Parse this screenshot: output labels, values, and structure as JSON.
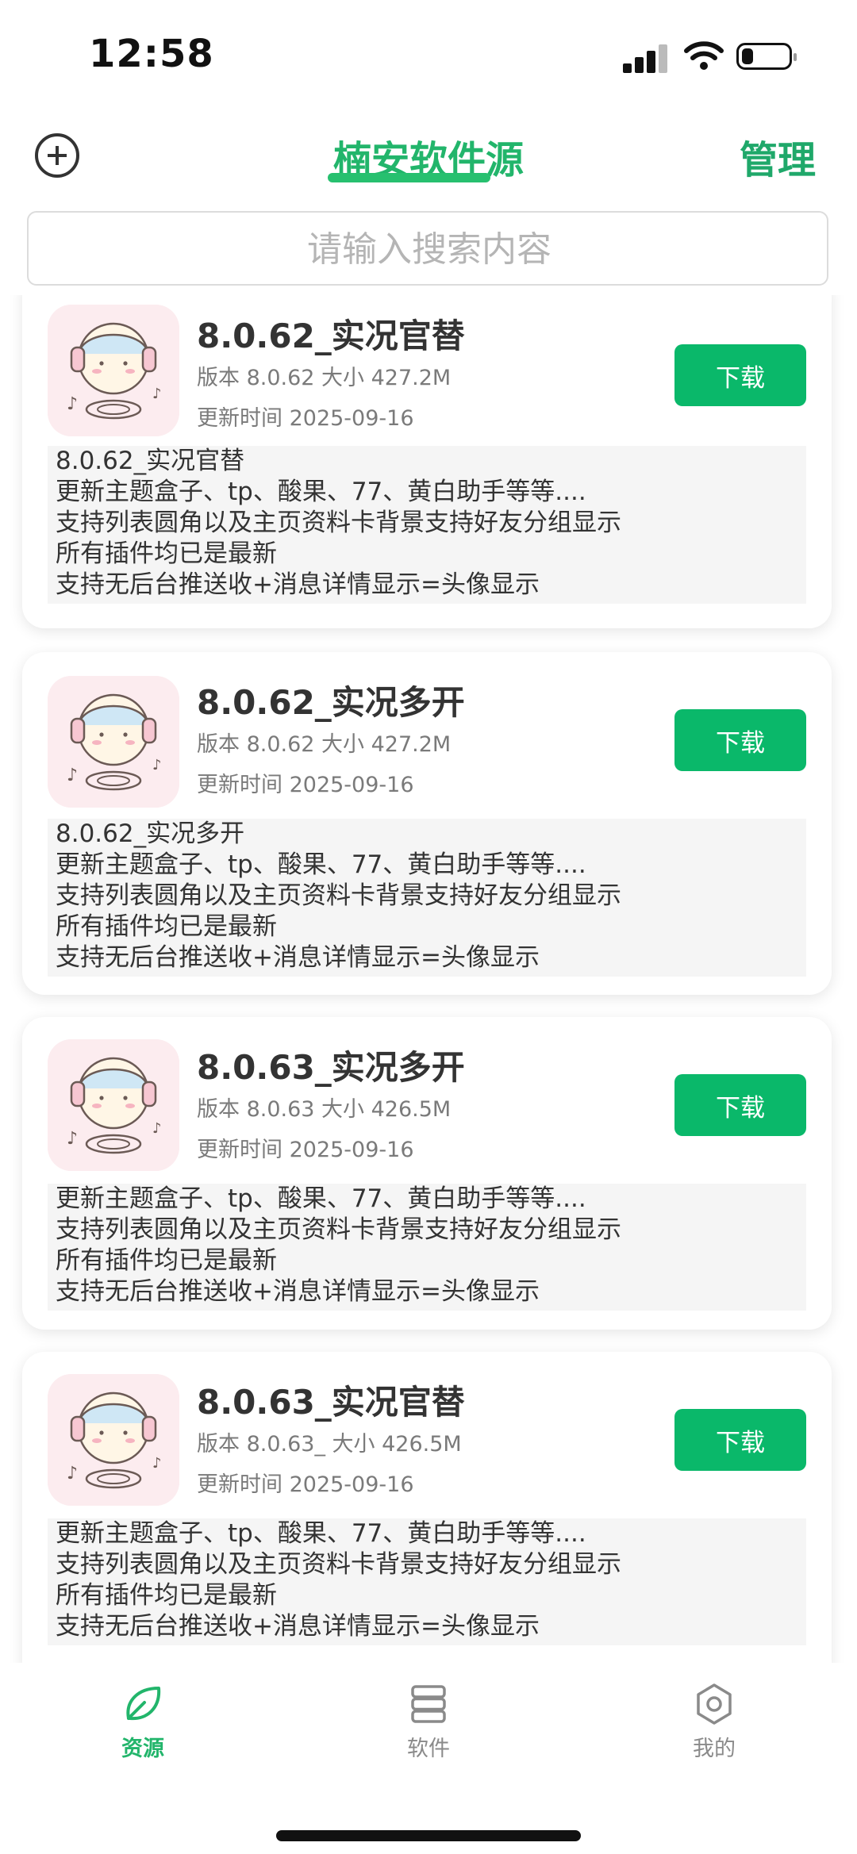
{
  "status": {
    "time": "12:58"
  },
  "header": {
    "title": "楠安软件源",
    "manage_label": "管理"
  },
  "search": {
    "placeholder": "请输入搜索内容"
  },
  "colors": {
    "accent": "#0ab86a",
    "title": "#22b56b"
  },
  "cards": [
    {
      "name": "8.0.62_实况官替",
      "info": "版本 8.0.62 大小 427.2M",
      "updated": "更新时间 2025-09-16",
      "download_label": "下载",
      "desc": [
        "8.0.62_实况官替",
        "更新主题盒子、tp、酸果、77、黄白助手等等....",
        "支持列表圆角以及主页资料卡背景支持好友分组显示",
        "所有插件均已是最新",
        "支持无后台推送收+消息详情显示=头像显示"
      ]
    },
    {
      "name": "8.0.62_实况多开",
      "info": "版本 8.0.62 大小 427.2M",
      "updated": "更新时间 2025-09-16",
      "download_label": "下载",
      "desc": [
        "8.0.62_实况多开",
        "更新主题盒子、tp、酸果、77、黄白助手等等....",
        "支持列表圆角以及主页资料卡背景支持好友分组显示",
        "所有插件均已是最新",
        "支持无后台推送收+消息详情显示=头像显示"
      ]
    },
    {
      "name": "8.0.63_实况多开",
      "info": "版本 8.0.63 大小 426.5M",
      "updated": "更新时间 2025-09-16",
      "download_label": "下载",
      "desc": [
        "更新主题盒子、tp、酸果、77、黄白助手等等....",
        "支持列表圆角以及主页资料卡背景支持好友分组显示",
        "所有插件均已是最新",
        "支持无后台推送收+消息详情显示=头像显示"
      ]
    },
    {
      "name": "8.0.63_实况官替",
      "info": "版本 8.0.63_ 大小 426.5M",
      "updated": "更新时间 2025-09-16",
      "download_label": "下载",
      "desc": [
        "更新主题盒子、tp、酸果、77、黄白助手等等....",
        "支持列表圆角以及主页资料卡背景支持好友分组显示",
        "所有插件均已是最新",
        "支持无后台推送收+消息详情显示=头像显示"
      ]
    }
  ],
  "tabs": [
    {
      "label": "资源",
      "icon": "leaf-icon",
      "active": true
    },
    {
      "label": "软件",
      "icon": "server-icon",
      "active": false
    },
    {
      "label": "我的",
      "icon": "gear-icon",
      "active": false
    }
  ]
}
